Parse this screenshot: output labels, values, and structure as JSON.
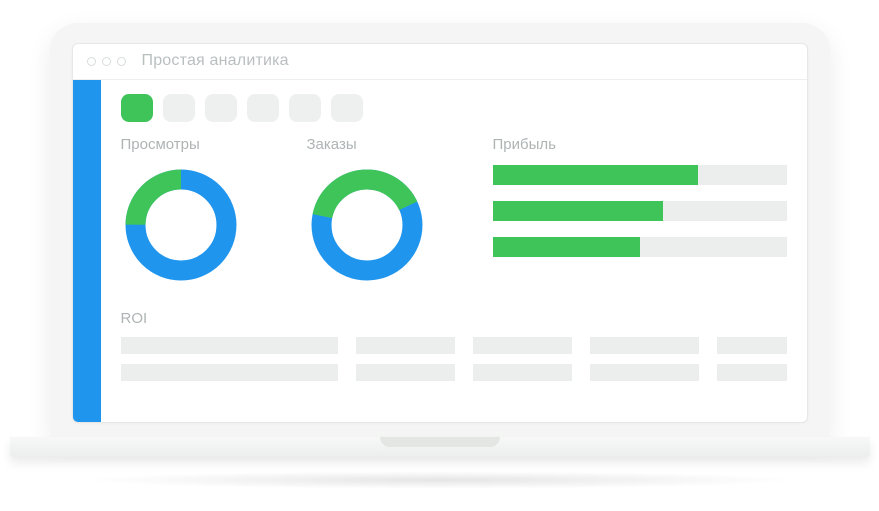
{
  "window": {
    "title": "Простая аналитика"
  },
  "tabs": {
    "count": 6,
    "active_index": 0
  },
  "sections": {
    "views": {
      "label": "Просмотры"
    },
    "orders": {
      "label": "Заказы"
    },
    "profit": {
      "label": "Прибыль"
    },
    "roi": {
      "label": "ROI"
    }
  },
  "colors": {
    "accent_blue": "#1f95ee",
    "accent_green": "#3fc45a",
    "placeholder": "#eceeee"
  },
  "chart_data": [
    {
      "type": "pie",
      "title": "Просмотры",
      "series": [
        {
          "name": "green",
          "value": 25
        },
        {
          "name": "blue",
          "value": 75
        }
      ]
    },
    {
      "type": "pie",
      "title": "Заказы",
      "series": [
        {
          "name": "green",
          "value": 40
        },
        {
          "name": "blue",
          "value": 60
        }
      ]
    },
    {
      "type": "bar",
      "title": "Прибыль",
      "categories": [
        "row1",
        "row2",
        "row3"
      ],
      "values": [
        70,
        58,
        50
      ],
      "ylim": [
        0,
        100
      ]
    }
  ],
  "roi": {
    "rows": 2,
    "cols": 5
  }
}
